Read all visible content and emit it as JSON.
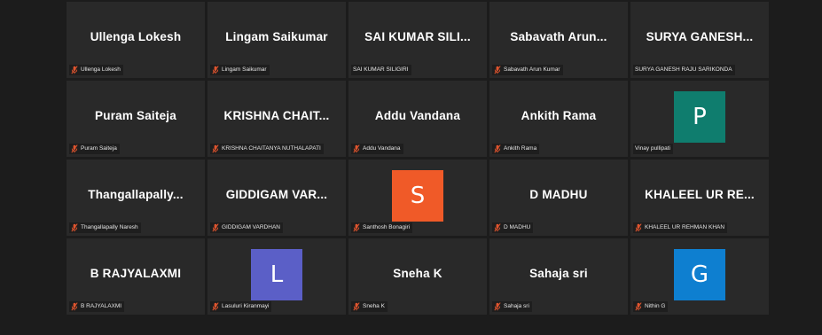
{
  "participants": [
    {
      "display": "Ullenga Lokesh",
      "name": "Ullenga Lokesh",
      "muted": true
    },
    {
      "display": "Lingam Saikumar",
      "name": "Lingam Saikumar",
      "muted": true
    },
    {
      "display": "SAI KUMAR SILI...",
      "name": "SAI KUMAR SILIGIRI",
      "muted": false
    },
    {
      "display": "Sabavath Arun...",
      "name": "Sabavath Arun Kumar",
      "muted": true
    },
    {
      "display": "SURYA GANESH...",
      "name": "SURYA GANESH RAJU SARIKONDA",
      "muted": false
    },
    {
      "display": "Puram Saiteja",
      "name": "Puram Saiteja",
      "muted": true
    },
    {
      "display": "KRISHNA CHAIT...",
      "name": "KRISHNA CHAITANYA NUTHALAPATI",
      "muted": true
    },
    {
      "display": "Addu Vandana",
      "name": "Addu Vandana",
      "muted": true
    },
    {
      "display": "Ankith Rama",
      "name": "Ankith Rama",
      "muted": true
    },
    {
      "avatar_letter": "P",
      "avatar_color": "#0f7d6e",
      "name": "Vinay pullipati",
      "muted": false
    },
    {
      "display": "Thangallapally...",
      "name": "Thangallapally Naresh",
      "muted": true
    },
    {
      "display": "GIDDIGAM VAR...",
      "name": "GIDDIGAM VARDHAN",
      "muted": true
    },
    {
      "avatar_letter": "S",
      "avatar_color": "#f05a28",
      "name": "Santhosh Bonagiri",
      "muted": true
    },
    {
      "display": "D MADHU",
      "name": "D MADHU",
      "muted": true
    },
    {
      "display": "KHALEEL UR RE...",
      "name": "KHALEEL UR REHMAN KHAN",
      "muted": true
    },
    {
      "display": "B RAJYALAXMI",
      "name": "B RAJYALAXMI",
      "muted": true
    },
    {
      "avatar_letter": "L",
      "avatar_color": "#5b5fc7",
      "name": "Lasuluri Kiranmayi",
      "muted": true
    },
    {
      "display": "Sneha K",
      "name": "Sneha K",
      "muted": true
    },
    {
      "display": "Sahaja sri",
      "name": "Sahaja sri",
      "muted": true
    },
    {
      "avatar_letter": "G",
      "avatar_color": "#0e7fd0",
      "name": "Nithin G",
      "muted": true
    }
  ],
  "mic_muted_color": "#e0542e",
  "icons": {
    "muted": "mic-muted-icon"
  }
}
